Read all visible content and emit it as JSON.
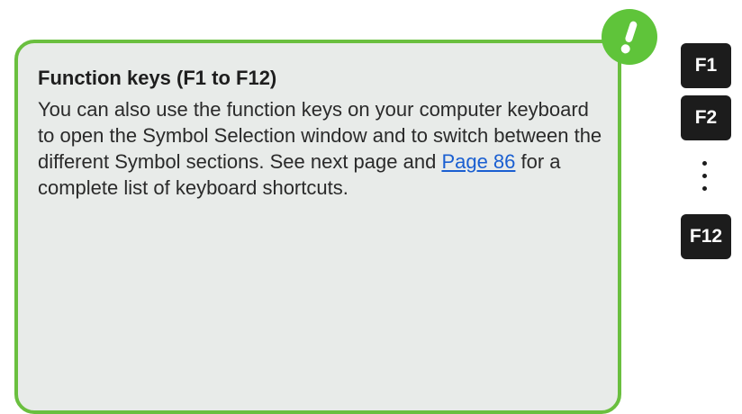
{
  "tip": {
    "title": "Function keys (F1 to F12)",
    "body_before_link": "You can also use the function keys on your computer keyboard to open the Symbol Selection window and to switch between the different Symbol sections. See next page and ",
    "link_text": "Page 86",
    "body_after_link": " for a complete list of keyboard shortcuts.",
    "border_color": "#6abf3f",
    "background_color": "#e8ebe9",
    "badge_icon": "exclamation-icon",
    "badge_color": "#5fc43a"
  },
  "keys": {
    "first": "F1",
    "second": "F2",
    "ellipsis_icon": "vertical-ellipsis-icon",
    "last": "F12"
  }
}
